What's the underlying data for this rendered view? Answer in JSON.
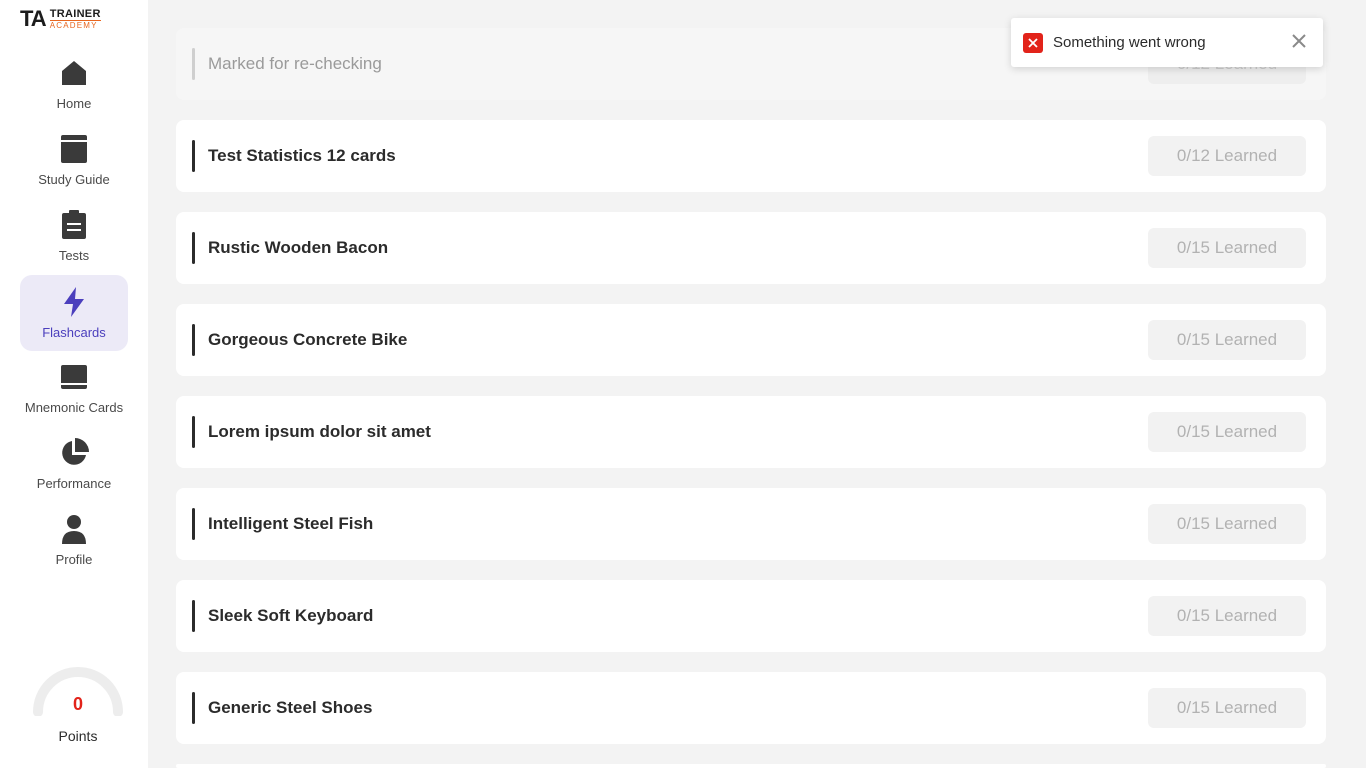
{
  "logo": {
    "mark": "TA",
    "line1": "TRAINER",
    "line2": "ACADEMY"
  },
  "nav": {
    "home": "Home",
    "study_guide": "Study Guide",
    "tests": "Tests",
    "flashcards": "Flashcards",
    "mnemonic_cards": "Mnemonic Cards",
    "performance": "Performance",
    "profile": "Profile"
  },
  "points": {
    "value": "0",
    "label": "Points"
  },
  "toast": {
    "message": "Something went wrong"
  },
  "decks": [
    {
      "title": "Marked for re-checking",
      "status": "0/12 Learned"
    },
    {
      "title": "Test Statistics 12 cards",
      "status": "0/12 Learned"
    },
    {
      "title": "Rustic Wooden Bacon",
      "status": "0/15 Learned"
    },
    {
      "title": "Gorgeous Concrete Bike",
      "status": "0/15 Learned"
    },
    {
      "title": "Lorem ipsum dolor sit amet",
      "status": "0/15 Learned"
    },
    {
      "title": "Intelligent Steel Fish",
      "status": "0/15 Learned"
    },
    {
      "title": "Sleek Soft Keyboard",
      "status": "0/15 Learned"
    },
    {
      "title": "Generic Steel Shoes",
      "status": "0/15 Learned"
    }
  ],
  "colors": {
    "accent": "#4b3fbd",
    "error": "#e2231a",
    "brand_orange": "#e8661f"
  }
}
